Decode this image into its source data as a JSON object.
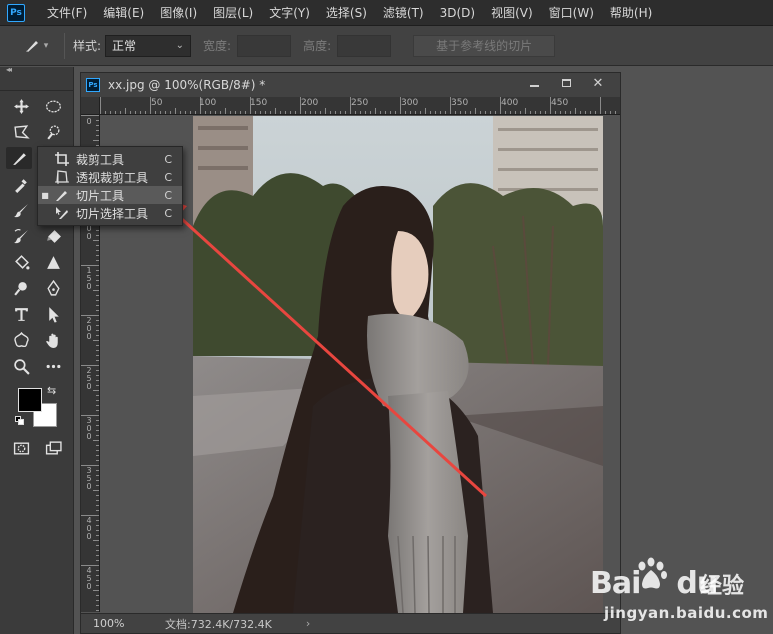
{
  "app": {
    "logo_text": "Ps"
  },
  "menu": [
    "文件(F)",
    "编辑(E)",
    "图像(I)",
    "图层(L)",
    "文字(Y)",
    "选择(S)",
    "滤镜(T)",
    "3D(D)",
    "视图(V)",
    "窗口(W)",
    "帮助(H)"
  ],
  "options": {
    "style_label": "样式:",
    "style_value": "正常",
    "width_label": "宽度:",
    "height_label": "高度:",
    "guides_button": "基于参考线的切片"
  },
  "document": {
    "title": "xx.jpg @ 100%(RGB/8#) *",
    "zoom": "100%",
    "doc_info": "文档:732.4K/732.4K",
    "ruler_h": [
      "50",
      "100",
      "150",
      "200",
      "250",
      "300",
      "350",
      "400",
      "450"
    ],
    "ruler_v": [
      "0",
      "50",
      "100",
      "150",
      "200",
      "250",
      "300",
      "350",
      "400",
      "450"
    ]
  },
  "flyout": {
    "items": [
      {
        "label": "裁剪工具",
        "key": "C",
        "selected": false,
        "current": false
      },
      {
        "label": "透视裁剪工具",
        "key": "C",
        "selected": false,
        "current": false
      },
      {
        "label": "切片工具",
        "key": "C",
        "selected": true,
        "current": true
      },
      {
        "label": "切片选择工具",
        "key": "C",
        "selected": false,
        "current": false
      }
    ]
  },
  "watermark": {
    "brand_a": "Bai",
    "brand_b": "du",
    "jingyan": "经验",
    "url": "jingyan.baidu.com"
  },
  "colors": {
    "accent": "#31a8ff",
    "annotation_arrow": "#e8463f",
    "foreground": "#000000",
    "background": "#ffffff"
  }
}
